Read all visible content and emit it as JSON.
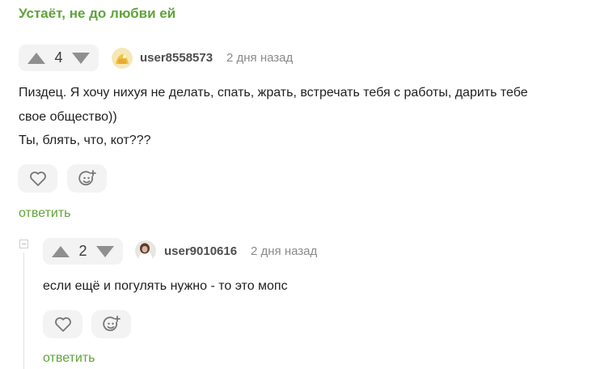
{
  "post_title_link": "Устаёт, не до любви ей",
  "comments": [
    {
      "rating": "4",
      "username": "user8558573",
      "time": "2 дня назад",
      "lines": [
        "Пиздец. Я хочу нихуя не делать, спать, жрать, встречать тебя с работы, дарить тебе",
        "свое общество))",
        "Ты, блять, что, кот???"
      ],
      "reply_label": "ответить"
    },
    {
      "rating": "2",
      "username": "user9010616",
      "time": "2 дня назад",
      "lines": [
        "если ещё и погулять нужно - то это мопс"
      ],
      "reply_label": "ответить"
    }
  ],
  "colors": {
    "accent": "#5fa33a",
    "pill_bg": "#f3f3f3",
    "icon": "#8f8f8f"
  },
  "icons": [
    "arrow-up-icon",
    "arrow-down-icon",
    "heart-icon",
    "emoji-add-icon",
    "collapse-icon"
  ]
}
